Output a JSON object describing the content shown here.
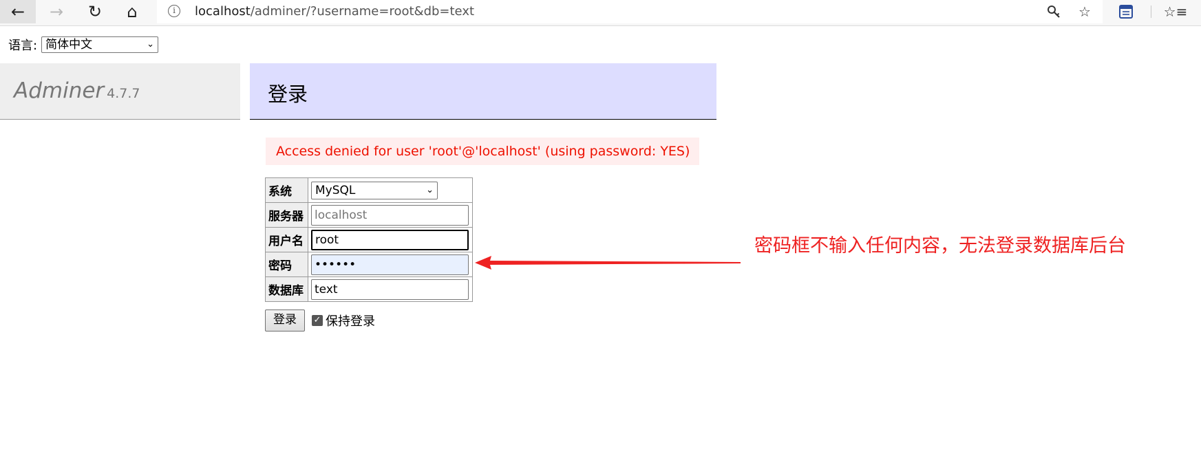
{
  "browser": {
    "url_host": "localhost",
    "url_path": "/adminer/?username=root&db=text"
  },
  "language": {
    "label": "语言:",
    "selected": "简体中文"
  },
  "brand": {
    "name": "Adminer",
    "version": "4.7.7"
  },
  "page": {
    "title": "登录",
    "error": "Access denied for user 'root'@'localhost' (using password: YES)"
  },
  "form": {
    "system_label": "系统",
    "system_value": "MySQL",
    "server_label": "服务器",
    "server_placeholder": "localhost",
    "username_label": "用户名",
    "username_value": "root",
    "password_label": "密码",
    "password_value": "••••••",
    "database_label": "数据库",
    "database_value": "text",
    "submit_label": "登录",
    "remember_label": "保持登录"
  },
  "annotation": {
    "text": "密码框不输入任何内容，无法登录数据库后台",
    "color": "#ee2222"
  }
}
